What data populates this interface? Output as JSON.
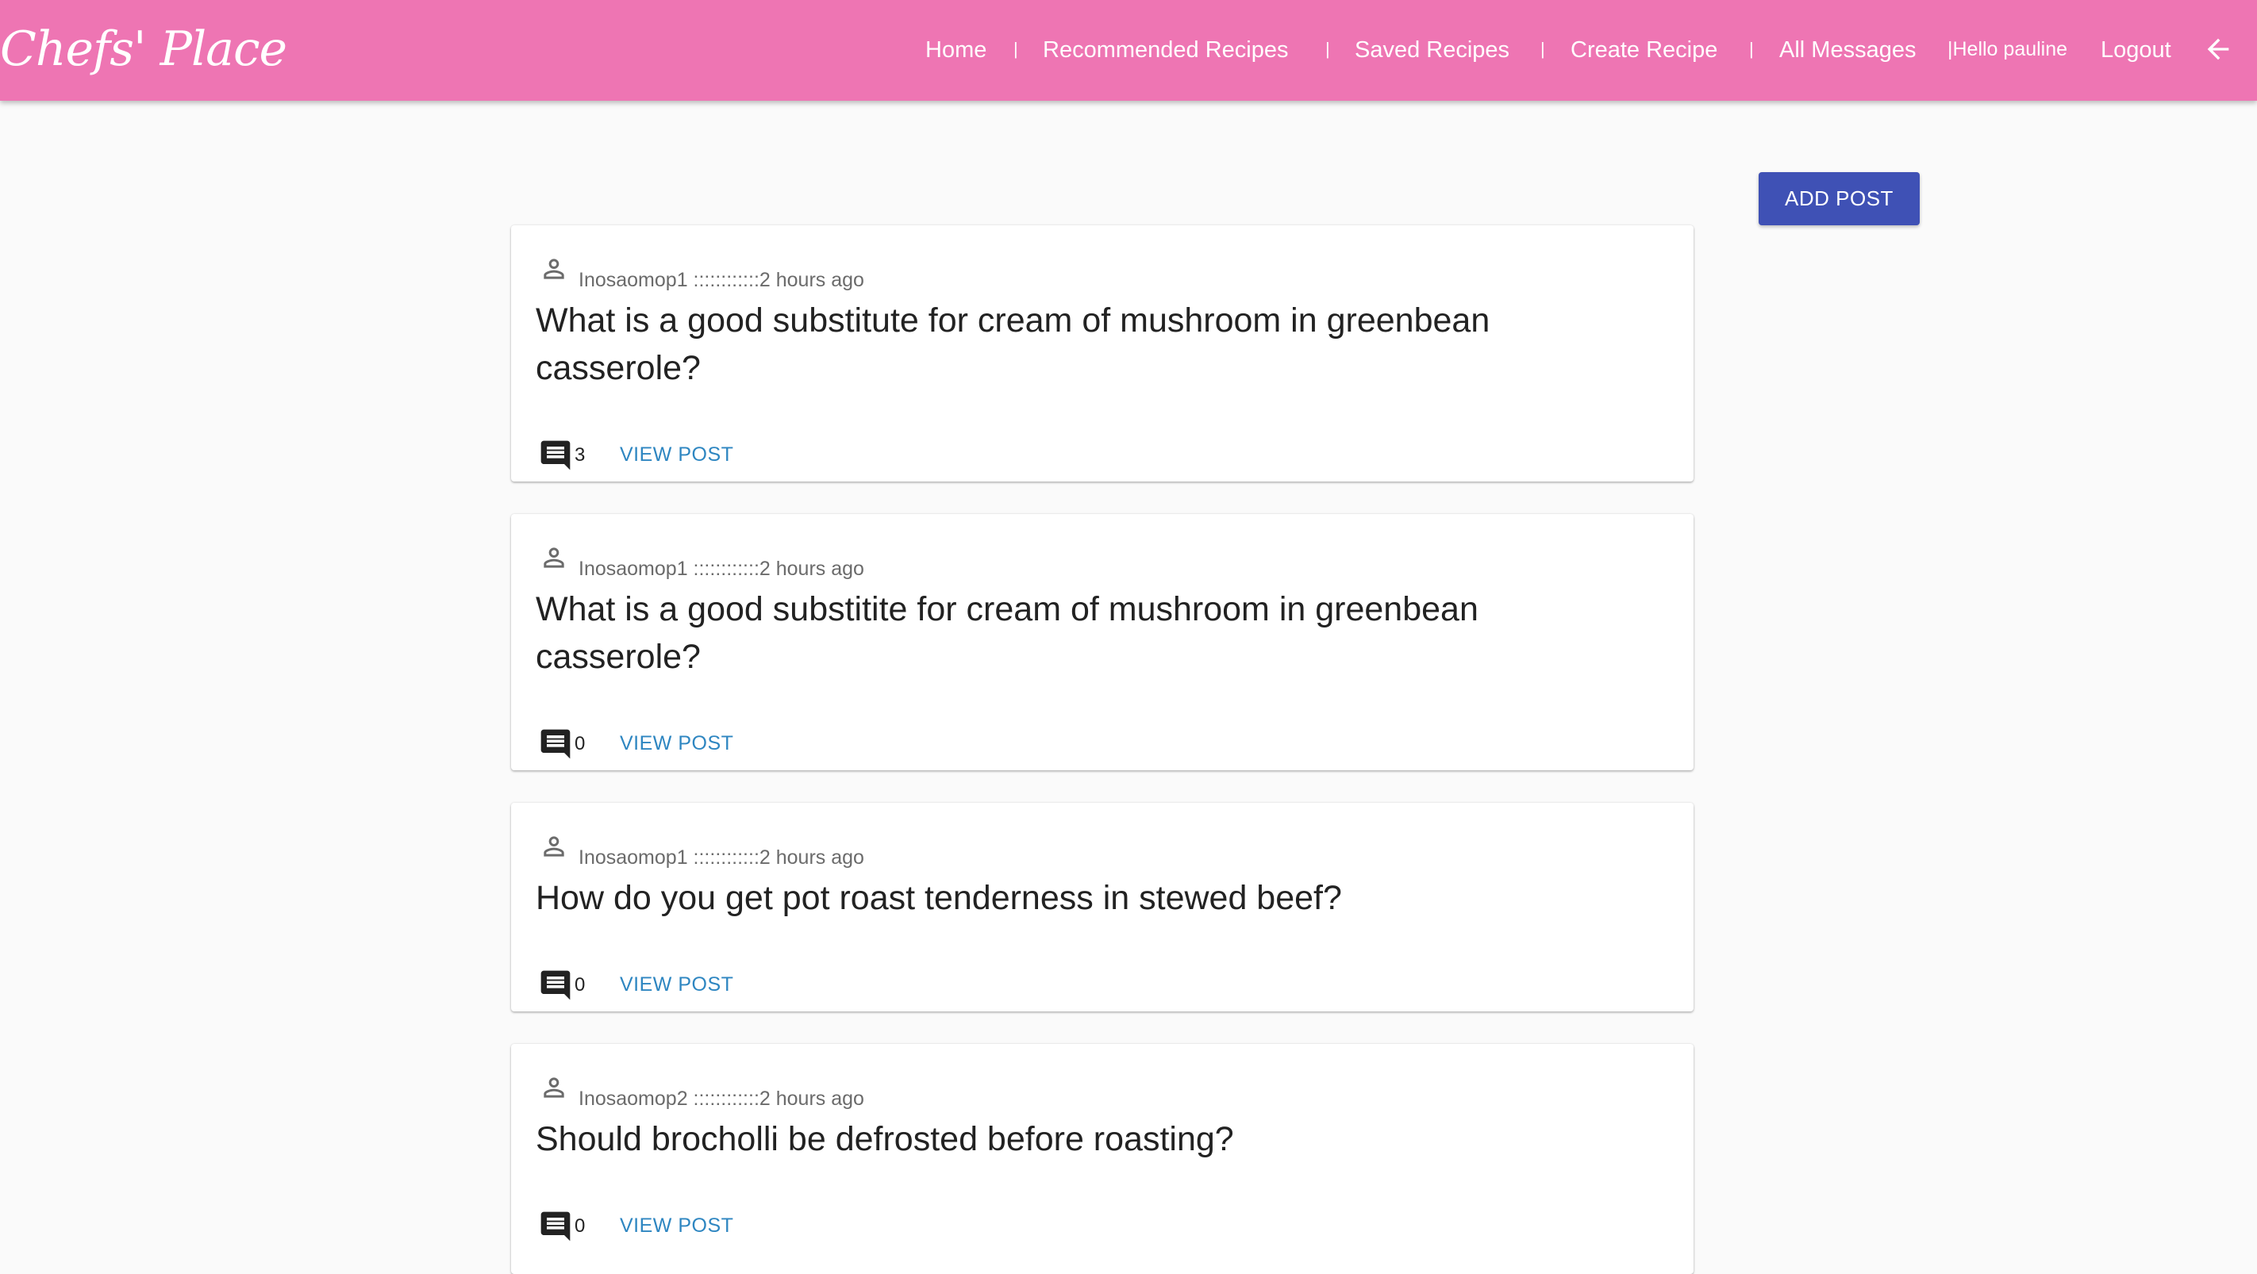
{
  "header": {
    "brand": "Chefs' Place",
    "nav": {
      "home": "Home",
      "recommended": "Recommended Recipes",
      "saved": "Saved Recipes",
      "create": "Create Recipe",
      "messages": "All Messages",
      "hello": "|Hello pauline",
      "logout": "Logout",
      "separator": "|"
    },
    "back_icon": "arrow-back-icon"
  },
  "toolbar": {
    "add_post": "ADD POST"
  },
  "posts": [
    {
      "author": "Inosaomop1",
      "meta": "Inosaomop1 ::::::::::::2 hours ago",
      "title": "What is a good substitute for cream of mushroom in greenbean casserole?",
      "comments": "3",
      "view_label": "VIEW POST"
    },
    {
      "author": "Inosaomop1",
      "meta": "Inosaomop1 ::::::::::::2 hours ago",
      "title": "What is a good substitite for cream of mushroom in greenbean casserole?",
      "comments": "0",
      "view_label": "VIEW POST"
    },
    {
      "author": "Inosaomop1",
      "meta": "Inosaomop1 ::::::::::::2 hours ago",
      "title": "How do you get pot roast tenderness in stewed beef?",
      "comments": "0",
      "view_label": "VIEW POST"
    },
    {
      "author": "Inosaomop2",
      "meta": "Inosaomop2 ::::::::::::2 hours ago",
      "title": "Should brocholli be defrosted before roasting?",
      "comments": "0",
      "view_label": "VIEW POST"
    }
  ],
  "colors": {
    "header_bg": "#ee75b3",
    "primary_button": "#3f51b5",
    "link": "#2e86c1",
    "page_bg": "#fafafa"
  }
}
